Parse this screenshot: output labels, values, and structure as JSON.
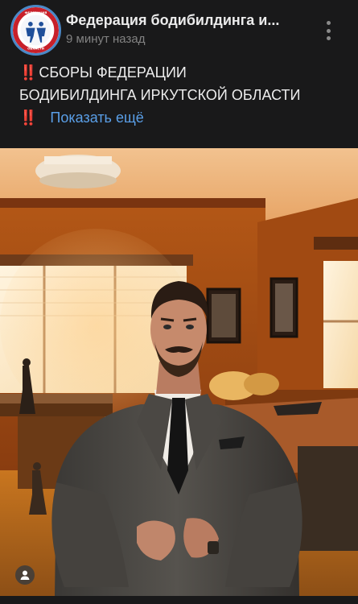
{
  "post": {
    "group_name": "Федерация бодибилдинга и...",
    "time": "9 минут назад",
    "text": {
      "line1": "СБОРЫ ФЕДЕРАЦИИ",
      "line2": "БОДИБИЛДИНГА ИРКУТСКОЙ ОБЛАСТИ",
      "emoji": "‼️",
      "show_more": "Показать ещё"
    },
    "avatar": {
      "top_text": "ФЕДЕРАЦИЯ БОДИБИЛДИНГА",
      "bottom_text": "ИРКУТСКОЙ ОБЛАСТИ"
    }
  },
  "icons": {
    "more": "more-vertical-icon",
    "author": "person-icon"
  },
  "colors": {
    "background": "#19191a",
    "accent_link": "#5a9fe8",
    "emoji_red": "#e7312f",
    "avatar_ring": "#4a88c7"
  }
}
